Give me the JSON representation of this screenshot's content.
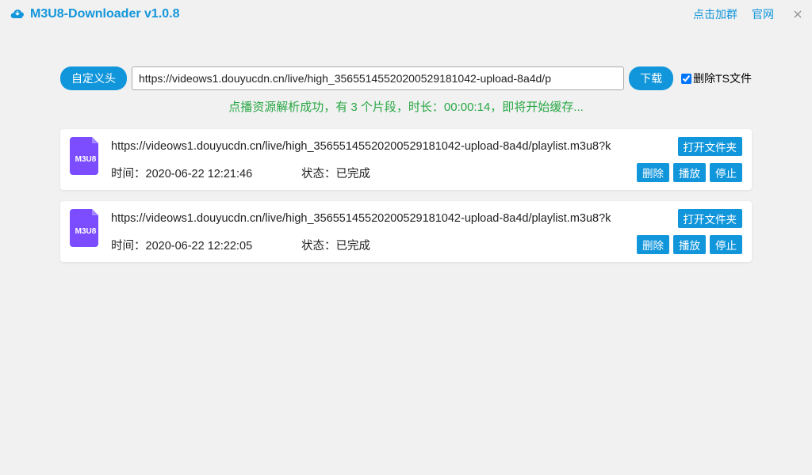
{
  "header": {
    "title": "M3U8-Downloader v1.0.8",
    "join_group": "点击加群",
    "official_site": "官网"
  },
  "toolbar": {
    "custom_header": "自定义头",
    "url_value": "https://videows1.douyucdn.cn/live/high_3565514552020052918​1042-upload-8a4d/p",
    "download": "下载",
    "delete_ts": "删除TS文件"
  },
  "status_message": "点播资源解析成功，有 3 个片段，时长：00:00:14，即将开始缓存...",
  "task_labels": {
    "time_prefix": "时间：",
    "status_prefix": "状态：",
    "open_folder": "打开文件夹",
    "delete": "删除",
    "play": "播放",
    "stop": "停止"
  },
  "tasks": [
    {
      "url": "https://videows1.douyucdn.cn/live/high_3565514552020052918​1042-upload-8a4d/playlist.m3u8?k",
      "time": "2020-06-22 12:21:46",
      "status": "已完成"
    },
    {
      "url": "https://videows1.douyucdn.cn/live/high_3565514552020052918​1042-upload-8a4d/playlist.m3u8?k",
      "time": "2020-06-22 12:22:05",
      "status": "已完成"
    }
  ]
}
